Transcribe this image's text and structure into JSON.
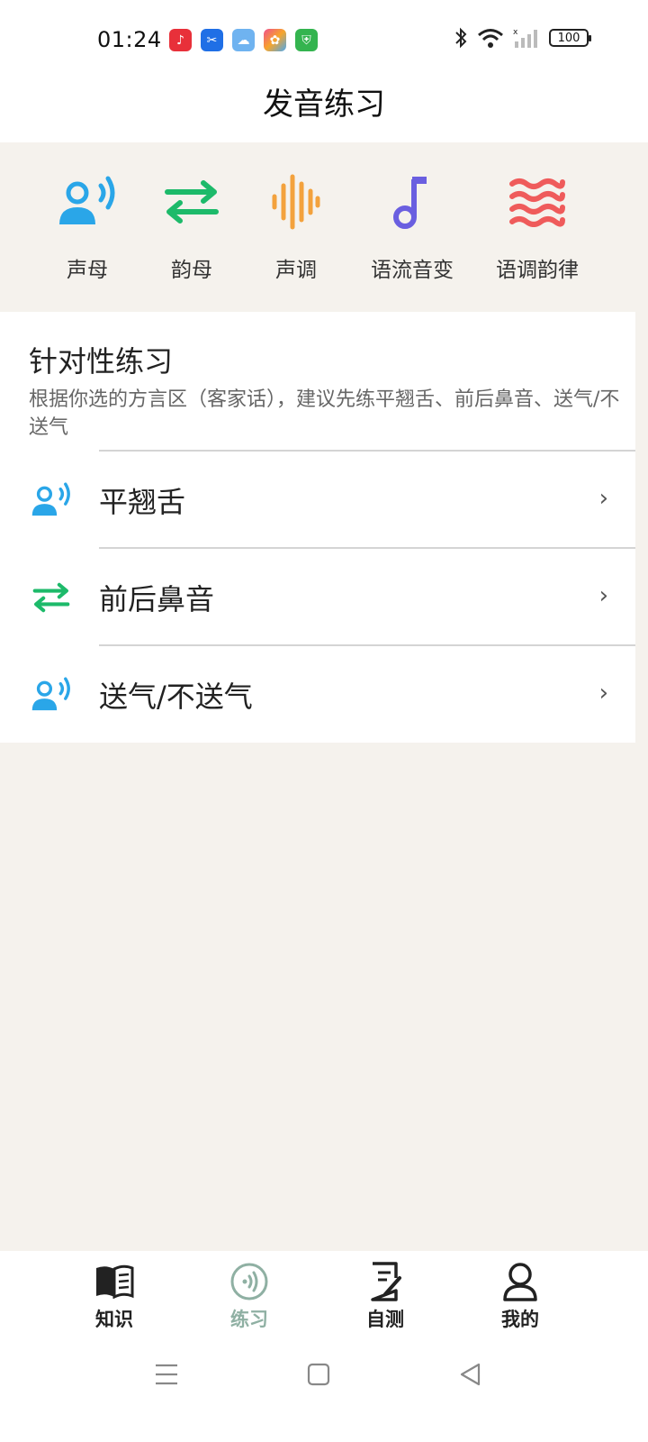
{
  "status_bar": {
    "time": "01:24",
    "battery": "100",
    "notification_icons": [
      "music-app-icon",
      "scissors-app-icon",
      "weather-app-icon",
      "photos-app-icon",
      "security-app-icon"
    ],
    "system_icons": [
      "bluetooth-icon",
      "wifi-icon",
      "signal-icon",
      "battery-icon"
    ]
  },
  "header": {
    "title": "发音练习"
  },
  "categories": [
    {
      "label": "声母",
      "icon": "speaker-person-icon",
      "color": "#2aa6e8"
    },
    {
      "label": "韵母",
      "icon": "swap-arrows-icon",
      "color": "#1dba6a"
    },
    {
      "label": "声调",
      "icon": "sound-wave-icon",
      "color": "#f3a23d"
    },
    {
      "label": "语流音变",
      "icon": "music-note-icon",
      "color": "#6a5fe0"
    },
    {
      "label": "语调韵律",
      "icon": "waves-icon",
      "color": "#ef5b5b"
    }
  ],
  "targeted": {
    "title": "针对性练习",
    "description": "根据你选的方言区（客家话），建议先练平翘舌、前后鼻音、送气/不送气",
    "items": [
      {
        "label": "平翘舌",
        "icon": "speaker-person-icon",
        "chevron": "›"
      },
      {
        "label": "前后鼻音",
        "icon": "swap-arrows-icon",
        "chevron": "›"
      },
      {
        "label": "送气/不送气",
        "icon": "speaker-person-icon",
        "chevron": "›"
      }
    ]
  },
  "bottom_nav": {
    "tabs": [
      {
        "label": "知识",
        "icon": "book-icon",
        "active": false
      },
      {
        "label": "练习",
        "icon": "practice-audio-icon",
        "active": true
      },
      {
        "label": "自测",
        "icon": "test-edit-icon",
        "active": false
      },
      {
        "label": "我的",
        "icon": "user-icon",
        "active": false
      }
    ],
    "active_color": "#8fb0a3"
  },
  "system_nav": [
    "menu-icon",
    "home-icon",
    "back-icon"
  ]
}
